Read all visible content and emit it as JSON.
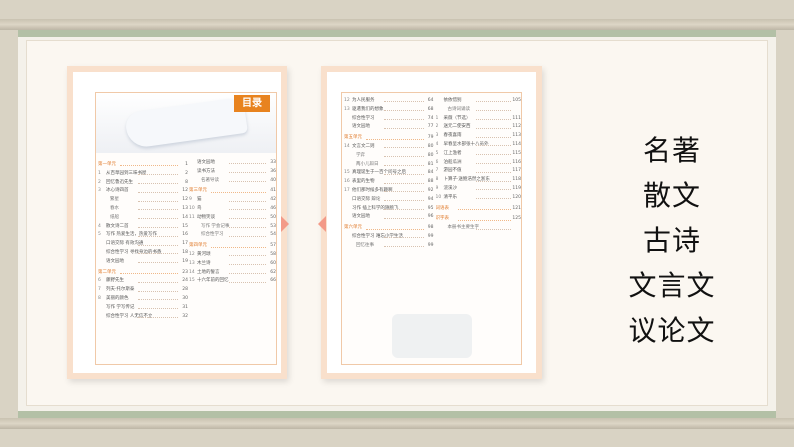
{
  "toc_badge": "目录",
  "left_page": {
    "col1": [
      {
        "type": "unit",
        "text": "第一单元",
        "page": "1"
      },
      {
        "num": "1",
        "text": "从百草园到三味书屋",
        "page": "2"
      },
      {
        "num": "2",
        "text": "回忆鲁迅先生",
        "page": "8"
      },
      {
        "num": "3",
        "text": "冰心诗四首",
        "page": "12"
      },
      {
        "type": "sub",
        "text": "繁星",
        "page": "12"
      },
      {
        "type": "sub",
        "text": "春水",
        "page": "13"
      },
      {
        "type": "sub",
        "text": "纸船",
        "page": "14"
      },
      {
        "num": "4",
        "text": "散文诗二首",
        "page": "15"
      },
      {
        "num": "5",
        "text": "写作 热爱生活，热爱写作",
        "page": "16"
      },
      {
        "num": "",
        "text": "口语交际 有效沟通",
        "page": "17"
      },
      {
        "num": "",
        "text": "综合性学习 寻找身边的书香",
        "page": "18"
      },
      {
        "num": "",
        "text": "语文园地",
        "page": "19"
      },
      {
        "type": "unit",
        "text": "第二单元",
        "page": "23"
      },
      {
        "num": "6",
        "text": "藤野先生",
        "page": "24"
      },
      {
        "num": "7",
        "text": "列夫·托尔斯泰",
        "page": "28"
      },
      {
        "num": "8",
        "text": "美丽的颜色",
        "page": "30"
      },
      {
        "num": "",
        "text": "写作 学写传记",
        "page": "31"
      },
      {
        "num": "",
        "text": "综合性学习 人无信不立",
        "page": "32"
      }
    ],
    "col2": [
      {
        "num": "",
        "text": "语文园地",
        "page": "33"
      },
      {
        "num": "",
        "text": "读书方法",
        "page": "36"
      },
      {
        "type": "sub",
        "text": "名著导读",
        "page": "40"
      },
      {
        "type": "unit",
        "text": "第三单元",
        "page": "41"
      },
      {
        "num": "9",
        "text": "猫",
        "page": "42"
      },
      {
        "num": "10",
        "text": "鸟",
        "page": "46"
      },
      {
        "num": "11",
        "text": "动物笑谈",
        "page": "50"
      },
      {
        "type": "sub",
        "text": "写作 学会记事",
        "page": "53"
      },
      {
        "type": "sub",
        "text": "综合性学习",
        "page": "54"
      },
      {
        "type": "unit",
        "text": "第四单元",
        "page": "57"
      },
      {
        "num": "12",
        "text": "黄河颂",
        "page": "58"
      },
      {
        "num": "13",
        "text": "木兰诗",
        "page": "60"
      },
      {
        "num": "14",
        "text": "土地的誓言",
        "page": "62"
      },
      {
        "num": "15",
        "text": "十六年前的回忆",
        "page": "66"
      }
    ]
  },
  "right_page": {
    "col1": [
      {
        "num": "12",
        "text": "为人民服务",
        "page": "64"
      },
      {
        "num": "13",
        "text": "驱遣我们的想象",
        "page": "68"
      },
      {
        "num": "",
        "text": "综合性学习",
        "page": "74"
      },
      {
        "num": "",
        "text": "语文园地",
        "page": "77"
      },
      {
        "type": "unit",
        "text": "第五单元",
        "page": "79"
      },
      {
        "num": "14",
        "text": "文言文二则",
        "page": "80"
      },
      {
        "type": "sub",
        "text": "学弈",
        "page": "80"
      },
      {
        "type": "sub",
        "text": "两小儿辩日",
        "page": "81"
      },
      {
        "num": "15",
        "text": "真理诞生于一百个问号之后",
        "page": "84"
      },
      {
        "num": "16",
        "text": "表里的生物",
        "page": "88"
      },
      {
        "num": "17",
        "text": "他们那时候多有趣啊",
        "page": "92"
      },
      {
        "num": "",
        "text": "口语交际 辩论",
        "page": "94"
      },
      {
        "num": "",
        "text": "习作 插上科学的翅膀飞",
        "page": "95"
      },
      {
        "num": "",
        "text": "语文园地",
        "page": "96"
      },
      {
        "type": "unit",
        "text": "第六单元",
        "page": "98"
      },
      {
        "num": "",
        "text": "综合性学习 难忘小学生活",
        "page": "99"
      },
      {
        "type": "sub",
        "text": "回忆往事",
        "page": "99"
      }
    ],
    "col2": [
      {
        "num": "",
        "text": "依依惜别",
        "page": "105"
      },
      {
        "type": "sub",
        "text": "古诗词诵读",
        "page": ""
      },
      {
        "num": "1",
        "text": "采薇（节选）",
        "page": "111"
      },
      {
        "num": "2",
        "text": "送元二使安西",
        "page": "112"
      },
      {
        "num": "3",
        "text": "春夜喜雨",
        "page": "113"
      },
      {
        "num": "4",
        "text": "早春呈水部张十八员外",
        "page": "114"
      },
      {
        "num": "5",
        "text": "江上渔者",
        "page": "115"
      },
      {
        "num": "6",
        "text": "泊船瓜洲",
        "page": "116"
      },
      {
        "num": "7",
        "text": "游园不值",
        "page": "117"
      },
      {
        "num": "8",
        "text": "卜算子·送鲍浩然之浙东",
        "page": "118"
      },
      {
        "num": "9",
        "text": "浣溪沙",
        "page": "119"
      },
      {
        "num": "10",
        "text": "清平乐",
        "page": "120"
      },
      {
        "type": "unit",
        "text": "词语表",
        "page": "121"
      },
      {
        "type": "unit",
        "text": "识字表",
        "page": "125"
      },
      {
        "type": "sub",
        "text": "本册书主要生字",
        "page": ""
      }
    ]
  },
  "keywords": [
    "名著",
    "散文",
    "古诗",
    "文言文",
    "议论文"
  ]
}
